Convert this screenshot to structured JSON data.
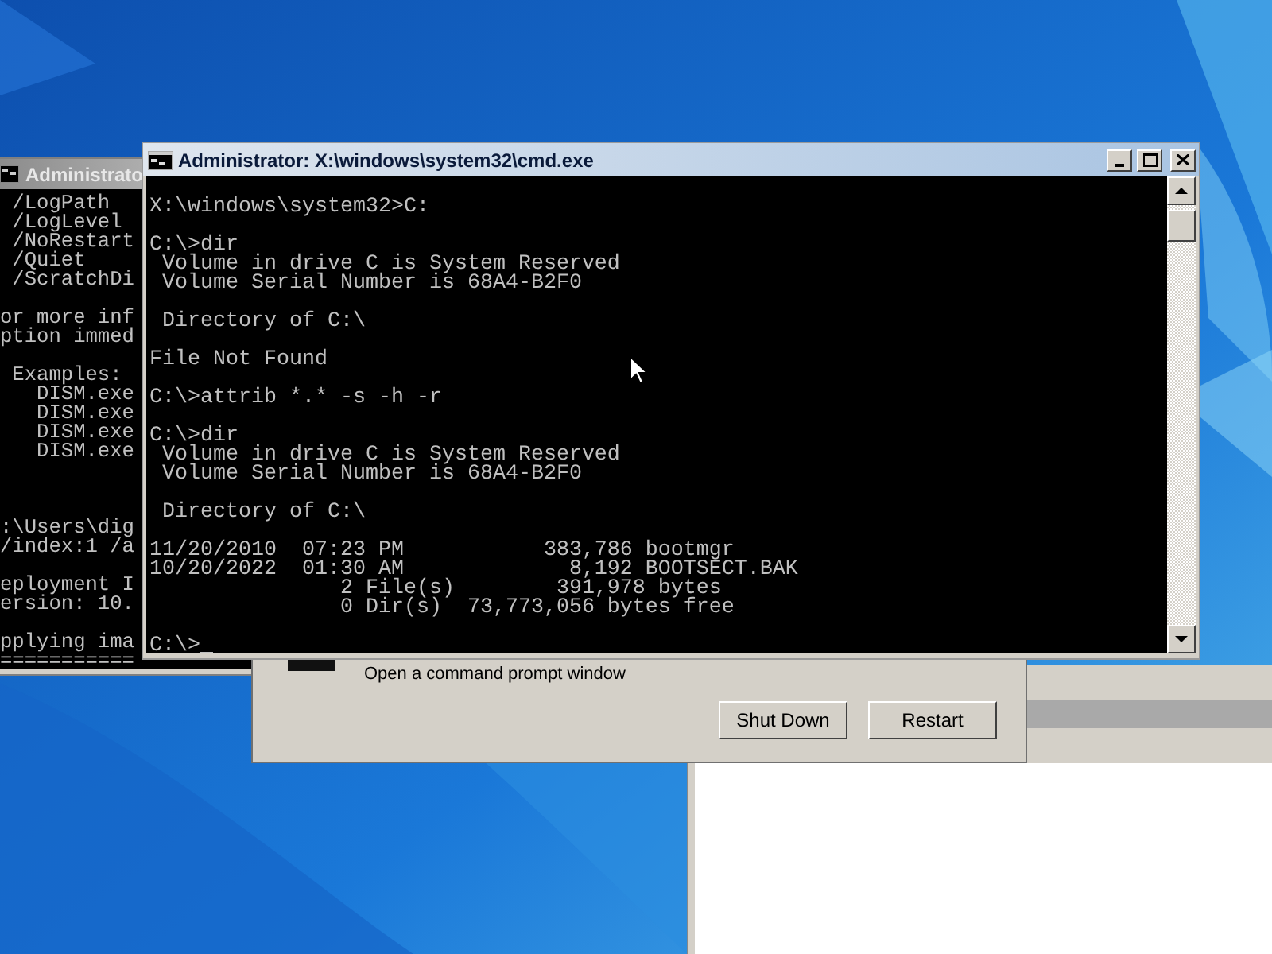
{
  "background_console": {
    "title": "Administrato",
    "active": false,
    "blocks": [
      {
        "lines": [
          " /LogPath",
          " /LogLevel",
          " /NoRestart",
          " /Quiet",
          " /ScratchDi"
        ]
      },
      {
        "lines": [
          "or more inf",
          "ption immed"
        ]
      },
      {
        "lines": [
          " Examples:",
          "   DISM.exe",
          "   DISM.exe",
          "   DISM.exe",
          "   DISM.exe"
        ]
      }
    ],
    "log_blocks": [
      {
        "lines": [
          ":\\Users\\dig",
          "/index:1 /a"
        ]
      },
      {
        "lines": [
          "eployment I",
          "ersion: 10."
        ]
      },
      {
        "lines": [
          "pplying ima",
          "==========="
        ]
      }
    ]
  },
  "recovery_dialog": {
    "text": "Open a command prompt window",
    "buttons": [
      "Shut Down",
      "Restart"
    ]
  },
  "console": {
    "title": "Administrator: X:\\windows\\system32\\cmd.exe",
    "active": true,
    "blocks": [
      {
        "lines": [
          "X:\\windows\\system32>C:"
        ]
      },
      {
        "lines": [
          "C:\\>dir",
          " Volume in drive C is System Reserved",
          " Volume Serial Number is 68A4-B2F0"
        ]
      },
      {
        "lines": [
          " Directory of C:\\"
        ]
      },
      {
        "lines": [
          "File Not Found"
        ]
      },
      {
        "lines": [
          "C:\\>attrib *.* -s -h -r"
        ]
      },
      {
        "lines": [
          "C:\\>dir",
          " Volume in drive C is System Reserved",
          " Volume Serial Number is 68A4-B2F0"
        ]
      },
      {
        "lines": [
          " Directory of C:\\"
        ]
      },
      {
        "lines": [
          "11/20/2010  07:23 PM           383,786 bootmgr",
          "10/20/2022  01:30 AM             8,192 BOOTSECT.BAK",
          "               2 File(s)        391,978 bytes",
          "               0 Dir(s)  73,773,056 bytes free"
        ]
      },
      {
        "lines": [
          "C:\\>"
        ],
        "cursor": true
      }
    ]
  }
}
